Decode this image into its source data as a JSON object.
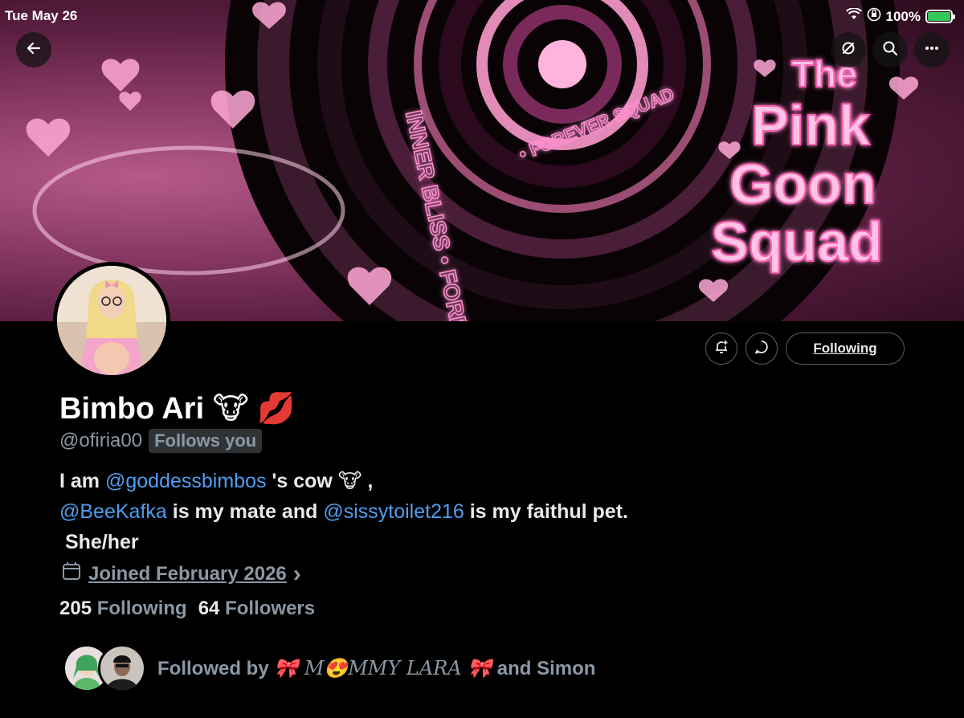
{
  "status": {
    "time": "Tue May 26",
    "battery": "100%"
  },
  "banner": {
    "title_lines": [
      "The",
      "Pink",
      "Goon",
      "Squad"
    ],
    "ring_text_outer": "INNER BLISS • FOREVER SQUAD",
    "ring_text_inner": "• FOREVER SQUAD"
  },
  "icons": {
    "back": "arrow-left-icon",
    "sync": "sync-icon",
    "search": "search-icon",
    "more": "more-icon",
    "notify": "bell-plus-icon",
    "message": "message-icon",
    "calendar": "calendar-icon"
  },
  "profile": {
    "name": "Bimbo Ari 🐮 💋",
    "handle": "@ofiria00",
    "follows_you": "Follows you",
    "following_button": "Following"
  },
  "bio": {
    "line1_prefix": "I am ",
    "line1_mention": "@goddessbimbos",
    "line1_suffix": " 's cow 🐮 ,",
    "line2_mention1": "@BeeKafka",
    "line2_mid": " is my mate and ",
    "line2_mention2": "@sissytoilet216",
    "line2_suffix": " is my faithul pet.",
    "line3": " She/her"
  },
  "joined": {
    "text": "Joined February 2026",
    "chevron": "›"
  },
  "stats": {
    "following_count": "205",
    "following_label": "Following",
    "followers_count": "64",
    "followers_label": "Followers"
  },
  "followed_by": {
    "prefix": "Followed by ",
    "name1": "🎀 M😍MMY LARA 🎀",
    "suffix": " and Simon"
  },
  "colors": {
    "link": "#4e9ef0",
    "muted": "#8b98a5",
    "accent_pink": "#ff8fd0"
  }
}
